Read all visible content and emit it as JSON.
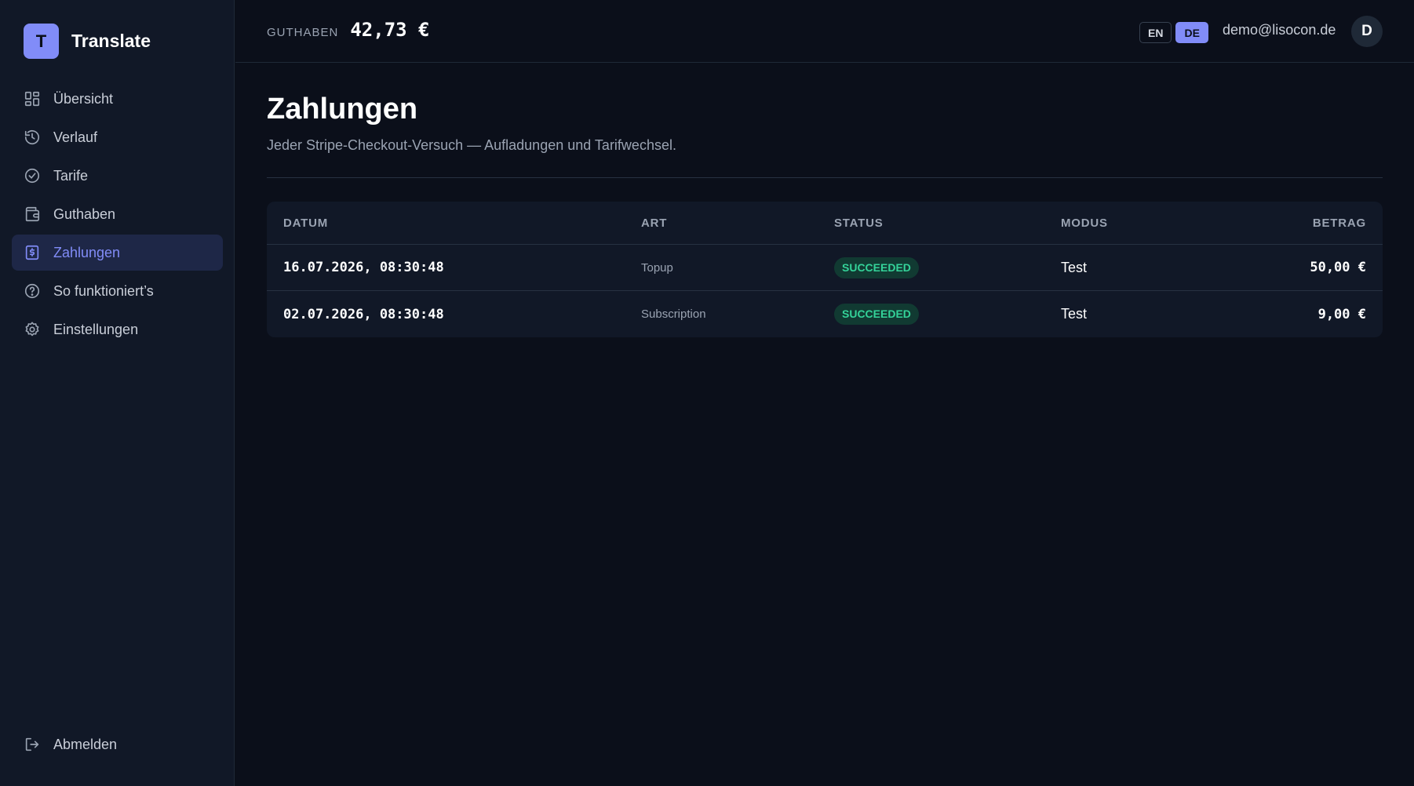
{
  "brand": {
    "logo_letter": "T",
    "name": "Translate",
    "accent": "#818cf8"
  },
  "sidebar": {
    "items": [
      {
        "label": "Übersicht",
        "icon": "dashboard-icon"
      },
      {
        "label": "Verlauf",
        "icon": "history-icon"
      },
      {
        "label": "Tarife",
        "icon": "check-circle-icon"
      },
      {
        "label": "Guthaben",
        "icon": "wallet-icon"
      },
      {
        "label": "Zahlungen",
        "icon": "receipt-dollar-icon",
        "active": true
      },
      {
        "label": "So funktioniert’s",
        "icon": "help-circle-icon"
      },
      {
        "label": "Einstellungen",
        "icon": "gear-icon"
      }
    ],
    "logout_label": "Abmelden"
  },
  "header": {
    "balance_label": "GUTHABEN",
    "balance_value": "42,73 €",
    "lang_en": "EN",
    "lang_de": "DE",
    "active_lang": "DE",
    "user_email": "demo@lisocon.de",
    "avatar_letter": "D"
  },
  "page": {
    "title": "Zahlungen",
    "subtitle": "Jeder Stripe-Checkout-Versuch — Aufladungen und Tarifwechsel."
  },
  "table": {
    "columns": {
      "date": "DATUM",
      "type": "ART",
      "status": "STATUS",
      "mode": "MODUS",
      "amount": "BETRAG"
    },
    "rows": [
      {
        "date": "16.07.2026, 08:30:48",
        "type": "Topup",
        "status": "SUCCEEDED",
        "mode": "Test",
        "amount": "50,00 €"
      },
      {
        "date": "02.07.2026, 08:30:48",
        "type": "Subscription",
        "status": "SUCCEEDED",
        "mode": "Test",
        "amount": "9,00 €"
      }
    ]
  },
  "colors": {
    "background": "#0b0f1a",
    "sidebar": "#111827",
    "success": "#34d399"
  }
}
